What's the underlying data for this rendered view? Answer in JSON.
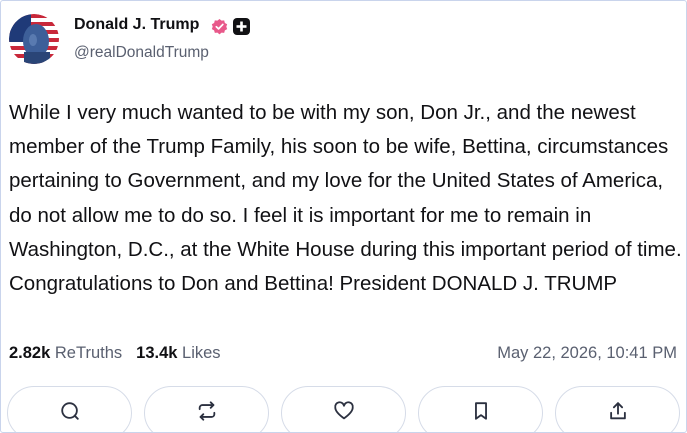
{
  "author": {
    "name": "Donald J. Trump",
    "handle": "@realDonaldTrump",
    "verified_color": "#e8598a"
  },
  "post": {
    "text": "While I very much wanted to be with my son, Don Jr., and the newest member of the Trump Family, his soon to be wife, Bettina, circumstances pertaining to Government, and my love for the United States of America, do not allow me to do so. I feel it is important for me to remain in Washington, D.C., at the White House during this important period of time. Congratulations to Don and Bettina! President DONALD J. TRUMP",
    "retruths_count": "2.82k",
    "retruths_label": "ReTruths",
    "likes_count": "13.4k",
    "likes_label": "Likes",
    "timestamp": "May 22, 2026, 10:41 PM"
  },
  "actions": [
    {
      "icon": "reply-icon"
    },
    {
      "icon": "retruth-icon"
    },
    {
      "icon": "like-heart-icon"
    },
    {
      "icon": "bookmark-icon"
    },
    {
      "icon": "share-icon"
    }
  ],
  "colors": {
    "text": "#111114",
    "muted": "#5a6070",
    "border": "#c9d4ec",
    "button_border": "#d6dce8"
  }
}
